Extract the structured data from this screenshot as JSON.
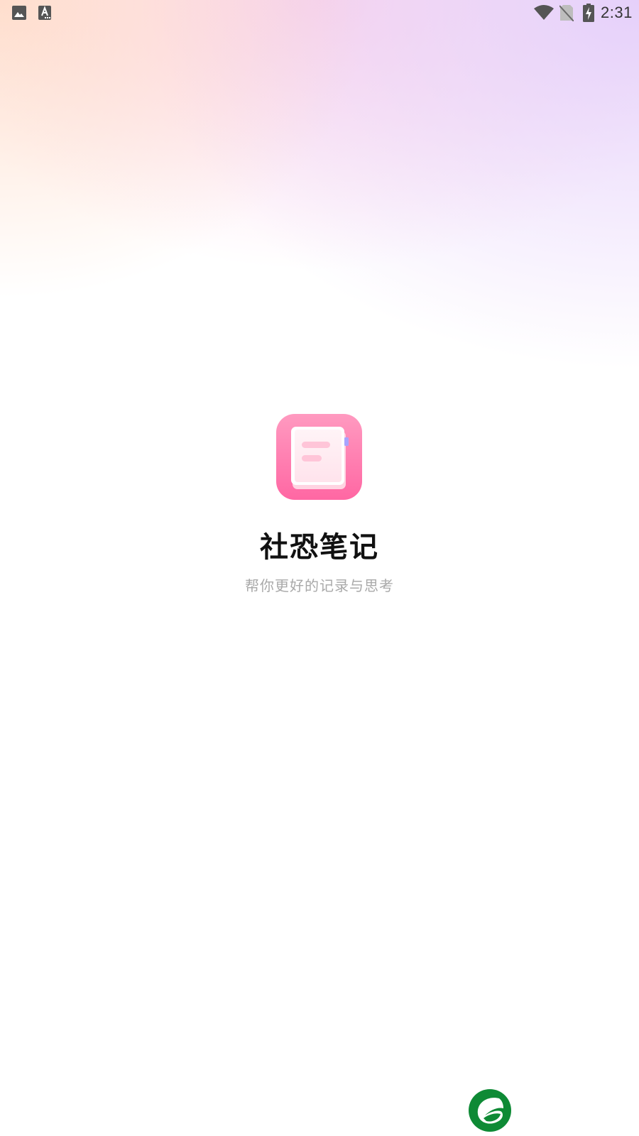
{
  "status_bar": {
    "time": "2:31",
    "icons": [
      "image-icon",
      "text-a-icon",
      "wifi-icon",
      "no-sim-icon",
      "battery-charging-icon"
    ]
  },
  "app": {
    "name": "社恐笔记",
    "tagline": "帮你更好的记录与思考",
    "icon": "notebook-icon"
  },
  "brand": {
    "icon": "leaf-g-logo-icon",
    "color": "#0e8a35"
  },
  "colors": {
    "icon_gradient_top": "#ff9ac0",
    "icon_gradient_bottom": "#ff6aa5",
    "title": "#111111",
    "tagline": "#a9a9a9"
  }
}
